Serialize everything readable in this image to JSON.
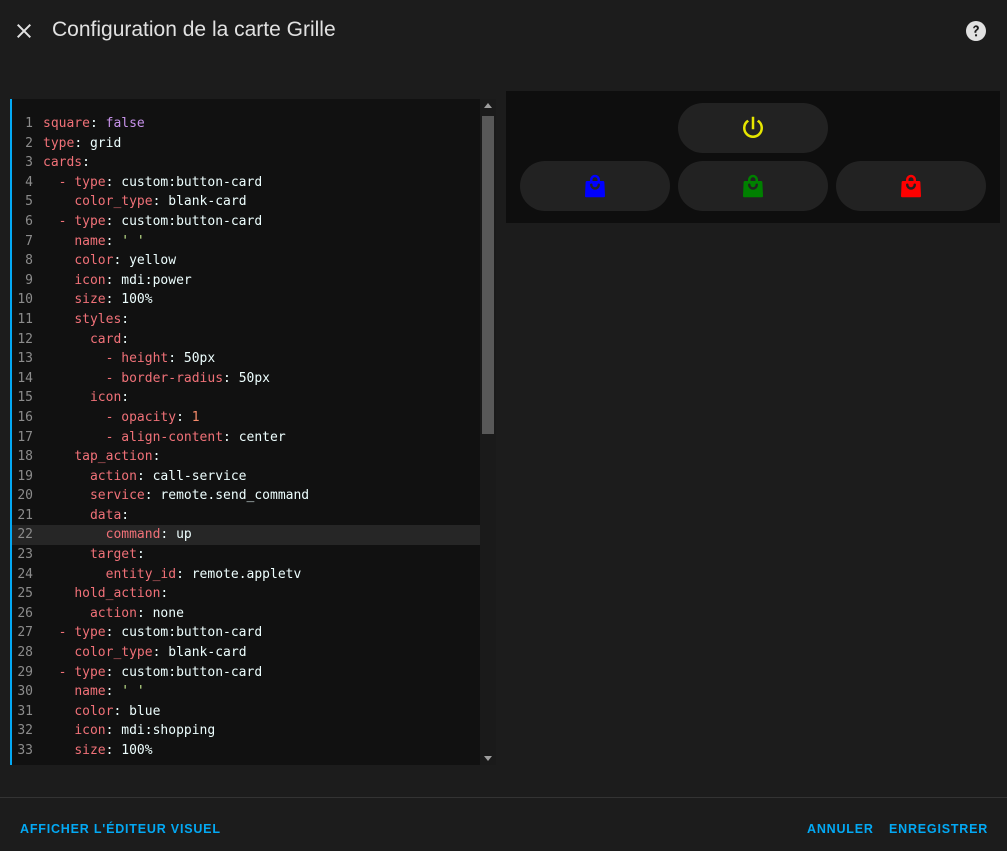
{
  "dialog": {
    "title": "Configuration de la carte Grille"
  },
  "editor": {
    "active_line": 22,
    "lines": [
      {
        "n": "1",
        "indent": "",
        "dash": false,
        "key": "square",
        "value": "false",
        "vclass": "b"
      },
      {
        "n": "2",
        "indent": "",
        "dash": false,
        "key": "type",
        "value": "grid",
        "vclass": "v"
      },
      {
        "n": "3",
        "indent": "",
        "dash": false,
        "key": "cards",
        "value": "",
        "vclass": "v"
      },
      {
        "n": "4",
        "indent": "  ",
        "dash": true,
        "key": "type",
        "value": "custom:button-card",
        "vclass": "v"
      },
      {
        "n": "5",
        "indent": "    ",
        "dash": false,
        "key": "color_type",
        "value": "blank-card",
        "vclass": "v"
      },
      {
        "n": "6",
        "indent": "  ",
        "dash": true,
        "key": "type",
        "value": "custom:button-card",
        "vclass": "v"
      },
      {
        "n": "7",
        "indent": "    ",
        "dash": false,
        "key": "name",
        "value": "' '",
        "vclass": "s"
      },
      {
        "n": "8",
        "indent": "    ",
        "dash": false,
        "key": "color",
        "value": "yellow",
        "vclass": "v"
      },
      {
        "n": "9",
        "indent": "    ",
        "dash": false,
        "key": "icon",
        "value": "mdi:power",
        "vclass": "v"
      },
      {
        "n": "10",
        "indent": "    ",
        "dash": false,
        "key": "size",
        "value": "100%",
        "vclass": "v"
      },
      {
        "n": "11",
        "indent": "    ",
        "dash": false,
        "key": "styles",
        "value": "",
        "vclass": "v"
      },
      {
        "n": "12",
        "indent": "      ",
        "dash": false,
        "key": "card",
        "value": "",
        "vclass": "v"
      },
      {
        "n": "13",
        "indent": "        ",
        "dash": true,
        "key": "height",
        "value": "50px",
        "vclass": "v"
      },
      {
        "n": "14",
        "indent": "        ",
        "dash": true,
        "key": "border-radius",
        "value": "50px",
        "vclass": "v"
      },
      {
        "n": "15",
        "indent": "      ",
        "dash": false,
        "key": "icon",
        "value": "",
        "vclass": "v"
      },
      {
        "n": "16",
        "indent": "        ",
        "dash": true,
        "key": "opacity",
        "value": "1",
        "vclass": "n"
      },
      {
        "n": "17",
        "indent": "        ",
        "dash": true,
        "key": "align-content",
        "value": "center",
        "vclass": "v"
      },
      {
        "n": "18",
        "indent": "    ",
        "dash": false,
        "key": "tap_action",
        "value": "",
        "vclass": "v"
      },
      {
        "n": "19",
        "indent": "      ",
        "dash": false,
        "key": "action",
        "value": "call-service",
        "vclass": "v"
      },
      {
        "n": "20",
        "indent": "      ",
        "dash": false,
        "key": "service",
        "value": "remote.send_command",
        "vclass": "v"
      },
      {
        "n": "21",
        "indent": "      ",
        "dash": false,
        "key": "data",
        "value": "",
        "vclass": "v"
      },
      {
        "n": "22",
        "indent": "        ",
        "dash": false,
        "key": "command",
        "value": "up",
        "vclass": "v"
      },
      {
        "n": "23",
        "indent": "      ",
        "dash": false,
        "key": "target",
        "value": "",
        "vclass": "v"
      },
      {
        "n": "24",
        "indent": "        ",
        "dash": false,
        "key": "entity_id",
        "value": "remote.appletv",
        "vclass": "v"
      },
      {
        "n": "25",
        "indent": "    ",
        "dash": false,
        "key": "hold_action",
        "value": "",
        "vclass": "v"
      },
      {
        "n": "26",
        "indent": "      ",
        "dash": false,
        "key": "action",
        "value": "none",
        "vclass": "v"
      },
      {
        "n": "27",
        "indent": "  ",
        "dash": true,
        "key": "type",
        "value": "custom:button-card",
        "vclass": "v"
      },
      {
        "n": "28",
        "indent": "    ",
        "dash": false,
        "key": "color_type",
        "value": "blank-card",
        "vclass": "v"
      },
      {
        "n": "29",
        "indent": "  ",
        "dash": true,
        "key": "type",
        "value": "custom:button-card",
        "vclass": "v"
      },
      {
        "n": "30",
        "indent": "    ",
        "dash": false,
        "key": "name",
        "value": "' '",
        "vclass": "s"
      },
      {
        "n": "31",
        "indent": "    ",
        "dash": false,
        "key": "color",
        "value": "blue",
        "vclass": "v"
      },
      {
        "n": "32",
        "indent": "    ",
        "dash": false,
        "key": "icon",
        "value": "mdi:shopping",
        "vclass": "v"
      },
      {
        "n": "33",
        "indent": "    ",
        "dash": false,
        "key": "size",
        "value": "100%",
        "vclass": "v"
      }
    ]
  },
  "preview": {
    "buttons": [
      {
        "icon": "power-icon",
        "color": "#e6e600"
      },
      {
        "icon": "shopping-icon",
        "color": "#0000ff"
      },
      {
        "icon": "shopping-icon",
        "color": "#008000"
      },
      {
        "icon": "shopping-icon",
        "color": "#ff0000"
      }
    ]
  },
  "footer": {
    "visual_editor_label": "Afficher l'éditeur visuel",
    "cancel_label": "Annuler",
    "save_label": "Enregistrer"
  },
  "colors": {
    "accent": "#03a9f4"
  }
}
